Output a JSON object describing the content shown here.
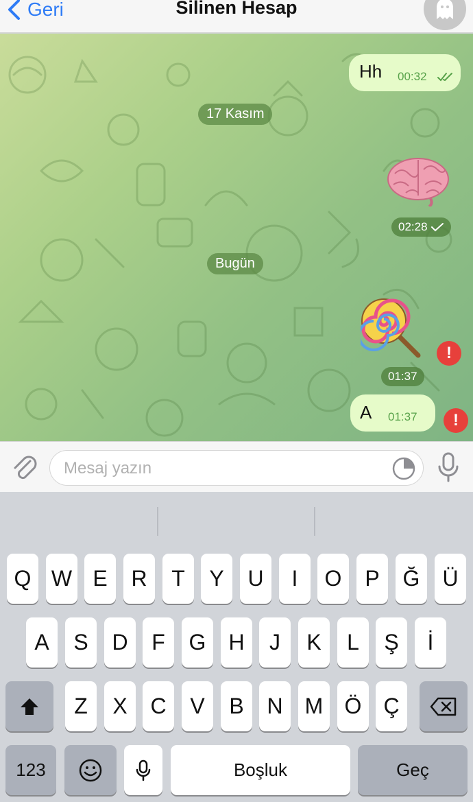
{
  "header": {
    "back_label": "Geri",
    "title": "Silinen Hesap"
  },
  "chat": {
    "date_separators": [
      "17 Kasım",
      "Bugün"
    ],
    "messages": [
      {
        "text": "Hh",
        "time": "00:32",
        "status": "read"
      },
      {
        "sticker": "brain-sticker",
        "time": "02:28",
        "status": "sent"
      },
      {
        "sticker": "lollipop-sticker",
        "time": "01:37",
        "status": "failed"
      },
      {
        "text": "A",
        "time": "01:37",
        "status": "failed"
      }
    ],
    "error_mark": "!"
  },
  "input": {
    "placeholder": "Mesaj yazın",
    "value": ""
  },
  "keyboard": {
    "row1": [
      "Q",
      "W",
      "E",
      "R",
      "T",
      "Y",
      "U",
      "I",
      "O",
      "P",
      "Ğ",
      "Ü"
    ],
    "row2": [
      "A",
      "S",
      "D",
      "F",
      "G",
      "H",
      "J",
      "K",
      "L",
      "Ş",
      "İ"
    ],
    "row3": [
      "Z",
      "X",
      "C",
      "V",
      "B",
      "N",
      "M",
      "Ö",
      "Ç"
    ],
    "numbers_label": "123",
    "space_label": "Boşluk",
    "return_label": "Geç"
  },
  "colors": {
    "accent": "#2f7cf6",
    "bubble": "#e6fbc9",
    "error": "#e7403b"
  }
}
